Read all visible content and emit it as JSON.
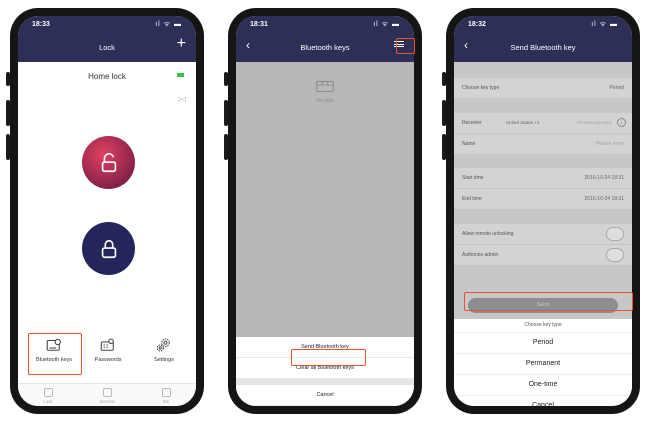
{
  "phone1": {
    "status_time": "18:33",
    "status_icons": "ıl ᯤ ▬",
    "title": "Lock",
    "add_symbol": "+",
    "lock_name": "Home lock",
    "small_indicator": "⊃◁",
    "toolbar": [
      "Bluetooth keys",
      "Passwords",
      "Settings"
    ],
    "tabs": [
      "Lock",
      "Service",
      "Me"
    ]
  },
  "phone2": {
    "status_time": "18:31",
    "status_icons": "ıl ᯤ ▬",
    "title": "Bluetooth keys",
    "no_data": "No data",
    "sheet": [
      "Send Bluetooth key",
      "Clear all Bluetooth keys",
      "Cancel"
    ]
  },
  "phone3": {
    "status_time": "18:32",
    "status_icons": "ıl ᯤ ▬",
    "title": "Send Bluetooth key",
    "rows": {
      "key_type_label": "Choose key type",
      "key_type_value": "Period",
      "receiver_label": "Receiver",
      "receiver_country": "United States +1",
      "receiver_placeholder": "Phone/Username",
      "name_label": "Name",
      "name_placeholder": "Please enter",
      "start_label": "Start time",
      "start_value": "2016-10-24 18:31",
      "end_label": "End time",
      "end_value": "2016-10-24 18:31",
      "remote_label": "Allow remote unlocking",
      "admin_label": "Authorize admin"
    },
    "send_label": "Send",
    "sheet_title": "Choose key type",
    "options": [
      "Period",
      "Permanent",
      "One-time",
      "Cancel"
    ]
  },
  "colors": {
    "navbar": "#2d2f57",
    "highlight": "#e8542e",
    "unlock_circle": "#c0375a",
    "lock_circle": "#24265b",
    "battery": "#39c14b"
  }
}
